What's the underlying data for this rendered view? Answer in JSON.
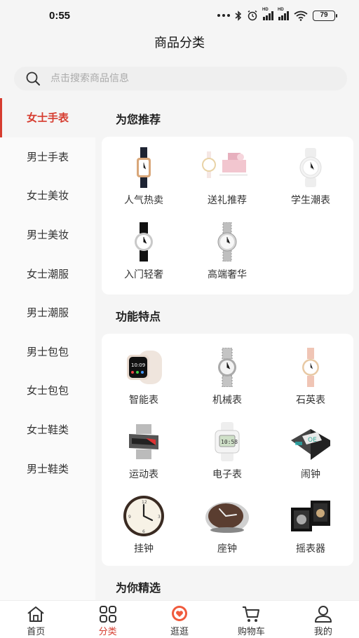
{
  "status": {
    "time": "0:55",
    "battery": "79"
  },
  "header": {
    "title": "商品分类"
  },
  "search": {
    "placeholder": "点击搜索商品信息"
  },
  "sidebar": {
    "items": [
      {
        "label": "女士手表",
        "active": true
      },
      {
        "label": "男士手表"
      },
      {
        "label": "女士美妆"
      },
      {
        "label": "男士美妆"
      },
      {
        "label": "女士潮服"
      },
      {
        "label": "男士潮服"
      },
      {
        "label": "男士包包"
      },
      {
        "label": "女士包包"
      },
      {
        "label": "女士鞋类"
      },
      {
        "label": "男士鞋类"
      }
    ]
  },
  "sections": [
    {
      "title": "为您推荐",
      "items": [
        {
          "label": "人气热卖",
          "icon": "leather-strap-watch-icon"
        },
        {
          "label": "送礼推荐",
          "icon": "gift-watch-set-icon"
        },
        {
          "label": "学生潮表",
          "icon": "white-sport-watch-icon"
        },
        {
          "label": "入门轻奢",
          "icon": "black-strap-watch-icon"
        },
        {
          "label": "高端奢华",
          "icon": "steel-bracelet-watch-icon"
        }
      ]
    },
    {
      "title": "功能特点",
      "items": [
        {
          "label": "智能表",
          "icon": "smartwatch-icon"
        },
        {
          "label": "机械表",
          "icon": "mechanical-watch-icon"
        },
        {
          "label": "石英表",
          "icon": "quartz-watch-icon"
        },
        {
          "label": "运动表",
          "icon": "sport-watch-icon"
        },
        {
          "label": "电子表",
          "icon": "digital-watch-icon"
        },
        {
          "label": "闹钟",
          "icon": "alarm-clock-icon"
        },
        {
          "label": "挂钟",
          "icon": "wall-clock-icon"
        },
        {
          "label": "座钟",
          "icon": "desk-clock-icon"
        },
        {
          "label": "摇表器",
          "icon": "watch-winder-icon"
        }
      ]
    },
    {
      "title": "为你精选"
    }
  ],
  "tabbar": {
    "items": [
      {
        "label": "首页",
        "icon": "home-icon"
      },
      {
        "label": "分类",
        "icon": "category-icon",
        "active": true
      },
      {
        "label": "逛逛",
        "icon": "heart-bubble-icon"
      },
      {
        "label": "购物车",
        "icon": "cart-icon"
      },
      {
        "label": "我的",
        "icon": "profile-icon"
      }
    ]
  },
  "colors": {
    "accent": "#d63c2f",
    "background": "#f5f5f5"
  }
}
